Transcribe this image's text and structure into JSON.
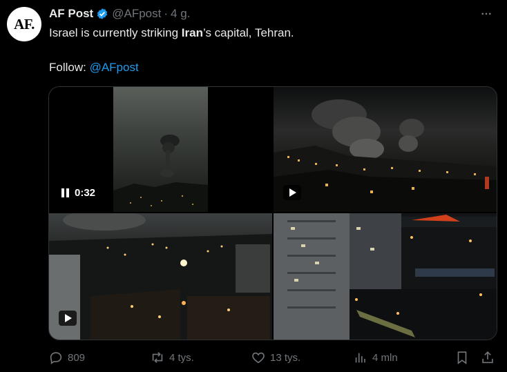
{
  "author": {
    "avatar_text": "AF.",
    "name": "AF Post",
    "handle": "@AFpost",
    "separator": "·",
    "time": "4 g."
  },
  "tweet": {
    "line1_before": "Israel is currently striking ",
    "line1_bold": "Iran",
    "line1_after": "’s capital, Tehran.",
    "follow_label": "Follow: ",
    "follow_link": "@AFpost"
  },
  "media": {
    "video_time": "0:32"
  },
  "actions": {
    "replies": "809",
    "reposts": "4 tys.",
    "likes": "13 tys.",
    "views": "4 mln"
  },
  "colors": {
    "accent": "#1d9bf0",
    "muted": "#71767b",
    "text": "#e7e9ea",
    "background": "#000000"
  },
  "icons": [
    "verified-badge-icon",
    "more-icon",
    "pause-icon",
    "play-icon",
    "reply-icon",
    "repost-icon",
    "like-icon",
    "views-icon",
    "bookmark-icon",
    "share-icon"
  ]
}
